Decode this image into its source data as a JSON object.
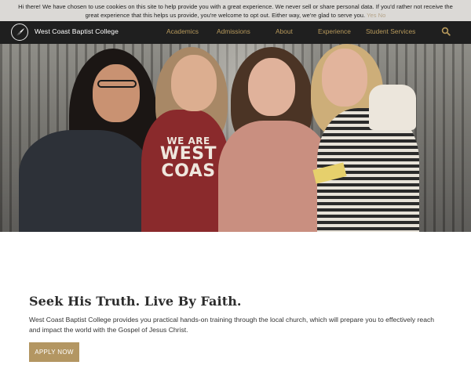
{
  "cookie_banner": {
    "message": "Hi there! We have chosen to use cookies on this site to help provide you with a great experience. We never sell or share personal data. If you'd rather not receive the great experience that this helps us provide, you're welcome to opt out. Either way, we're glad to serve you.",
    "opt_out_label": "Yes No"
  },
  "header": {
    "brand": "West Coast Baptist College",
    "nav": [
      "Academics",
      "Admissions",
      "About",
      "Experience",
      "Student Services"
    ],
    "search_icon": "search-icon"
  },
  "hero": {
    "shirt_text_small": "WE ARE",
    "shirt_text_big_1": "WEST",
    "shirt_text_big_2": "COAS"
  },
  "main": {
    "headline": "Seek His Truth. Live By Faith.",
    "intro": "West Coast Baptist College provides you practical hands-on training through the local church, which will prepare you to effectively reach and impact the world with the Gospel of Jesus Christ.",
    "apply_label": "APPLY NOW"
  },
  "colors": {
    "accent_gold": "#b39662",
    "nav_gold": "#b89a5c",
    "header_bg": "#1f1f1f"
  }
}
